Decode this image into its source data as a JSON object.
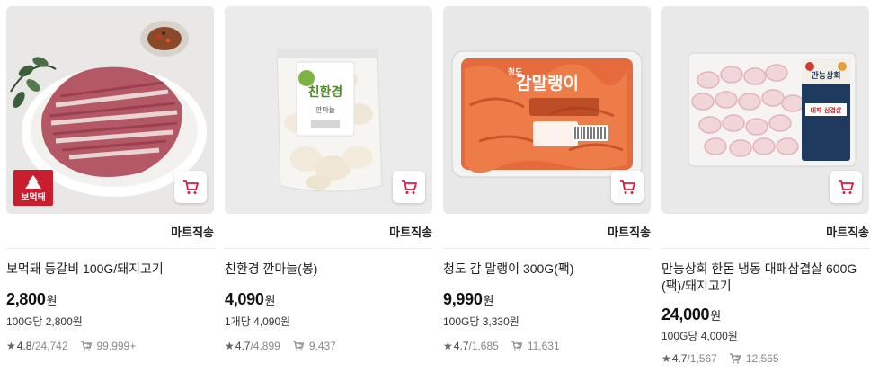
{
  "colors": {
    "cart_accent": "#e5173f"
  },
  "icons": {
    "cart": "cart-icon",
    "rating": "star-icon",
    "repeat": "repeat-buy-icon"
  },
  "products": [
    {
      "brand_badge": "보먹돼",
      "delivery": "마트직송",
      "name": "보먹돼 등갈비 100G/돼지고기",
      "price": "2,800",
      "currency": "원",
      "unit_price": "100G당 2,800원",
      "rating": "4.8",
      "review_count": "/24,742",
      "repeat_count": "99,999+"
    },
    {
      "package_brand": "친환경",
      "package_label": "깐마늘",
      "delivery": "마트직송",
      "name": "친환경 깐마늘(봉)",
      "price": "4,090",
      "currency": "원",
      "unit_price": "1개당 4,090원",
      "rating": "4.7",
      "review_count": "/4,899",
      "repeat_count": "9,437"
    },
    {
      "package_label": "감말랭이",
      "package_top": "청도",
      "delivery": "마트직송",
      "name": "청도 감 말랭이 300G(팩)",
      "price": "9,990",
      "currency": "원",
      "unit_price": "100G당 3,330원",
      "rating": "4.7",
      "review_count": "/1,685",
      "repeat_count": "11,631"
    },
    {
      "package_brand": "만능상회",
      "package_label": "대패 삼겹살",
      "delivery": "마트직송",
      "name": "만능상회 한돈 냉동 대패삼겹살 600G (팩)/돼지고기",
      "price": "24,000",
      "currency": "원",
      "unit_price": "100G당 4,000원",
      "rating": "4.7",
      "review_count": "/1,567",
      "repeat_count": "12,565"
    }
  ]
}
